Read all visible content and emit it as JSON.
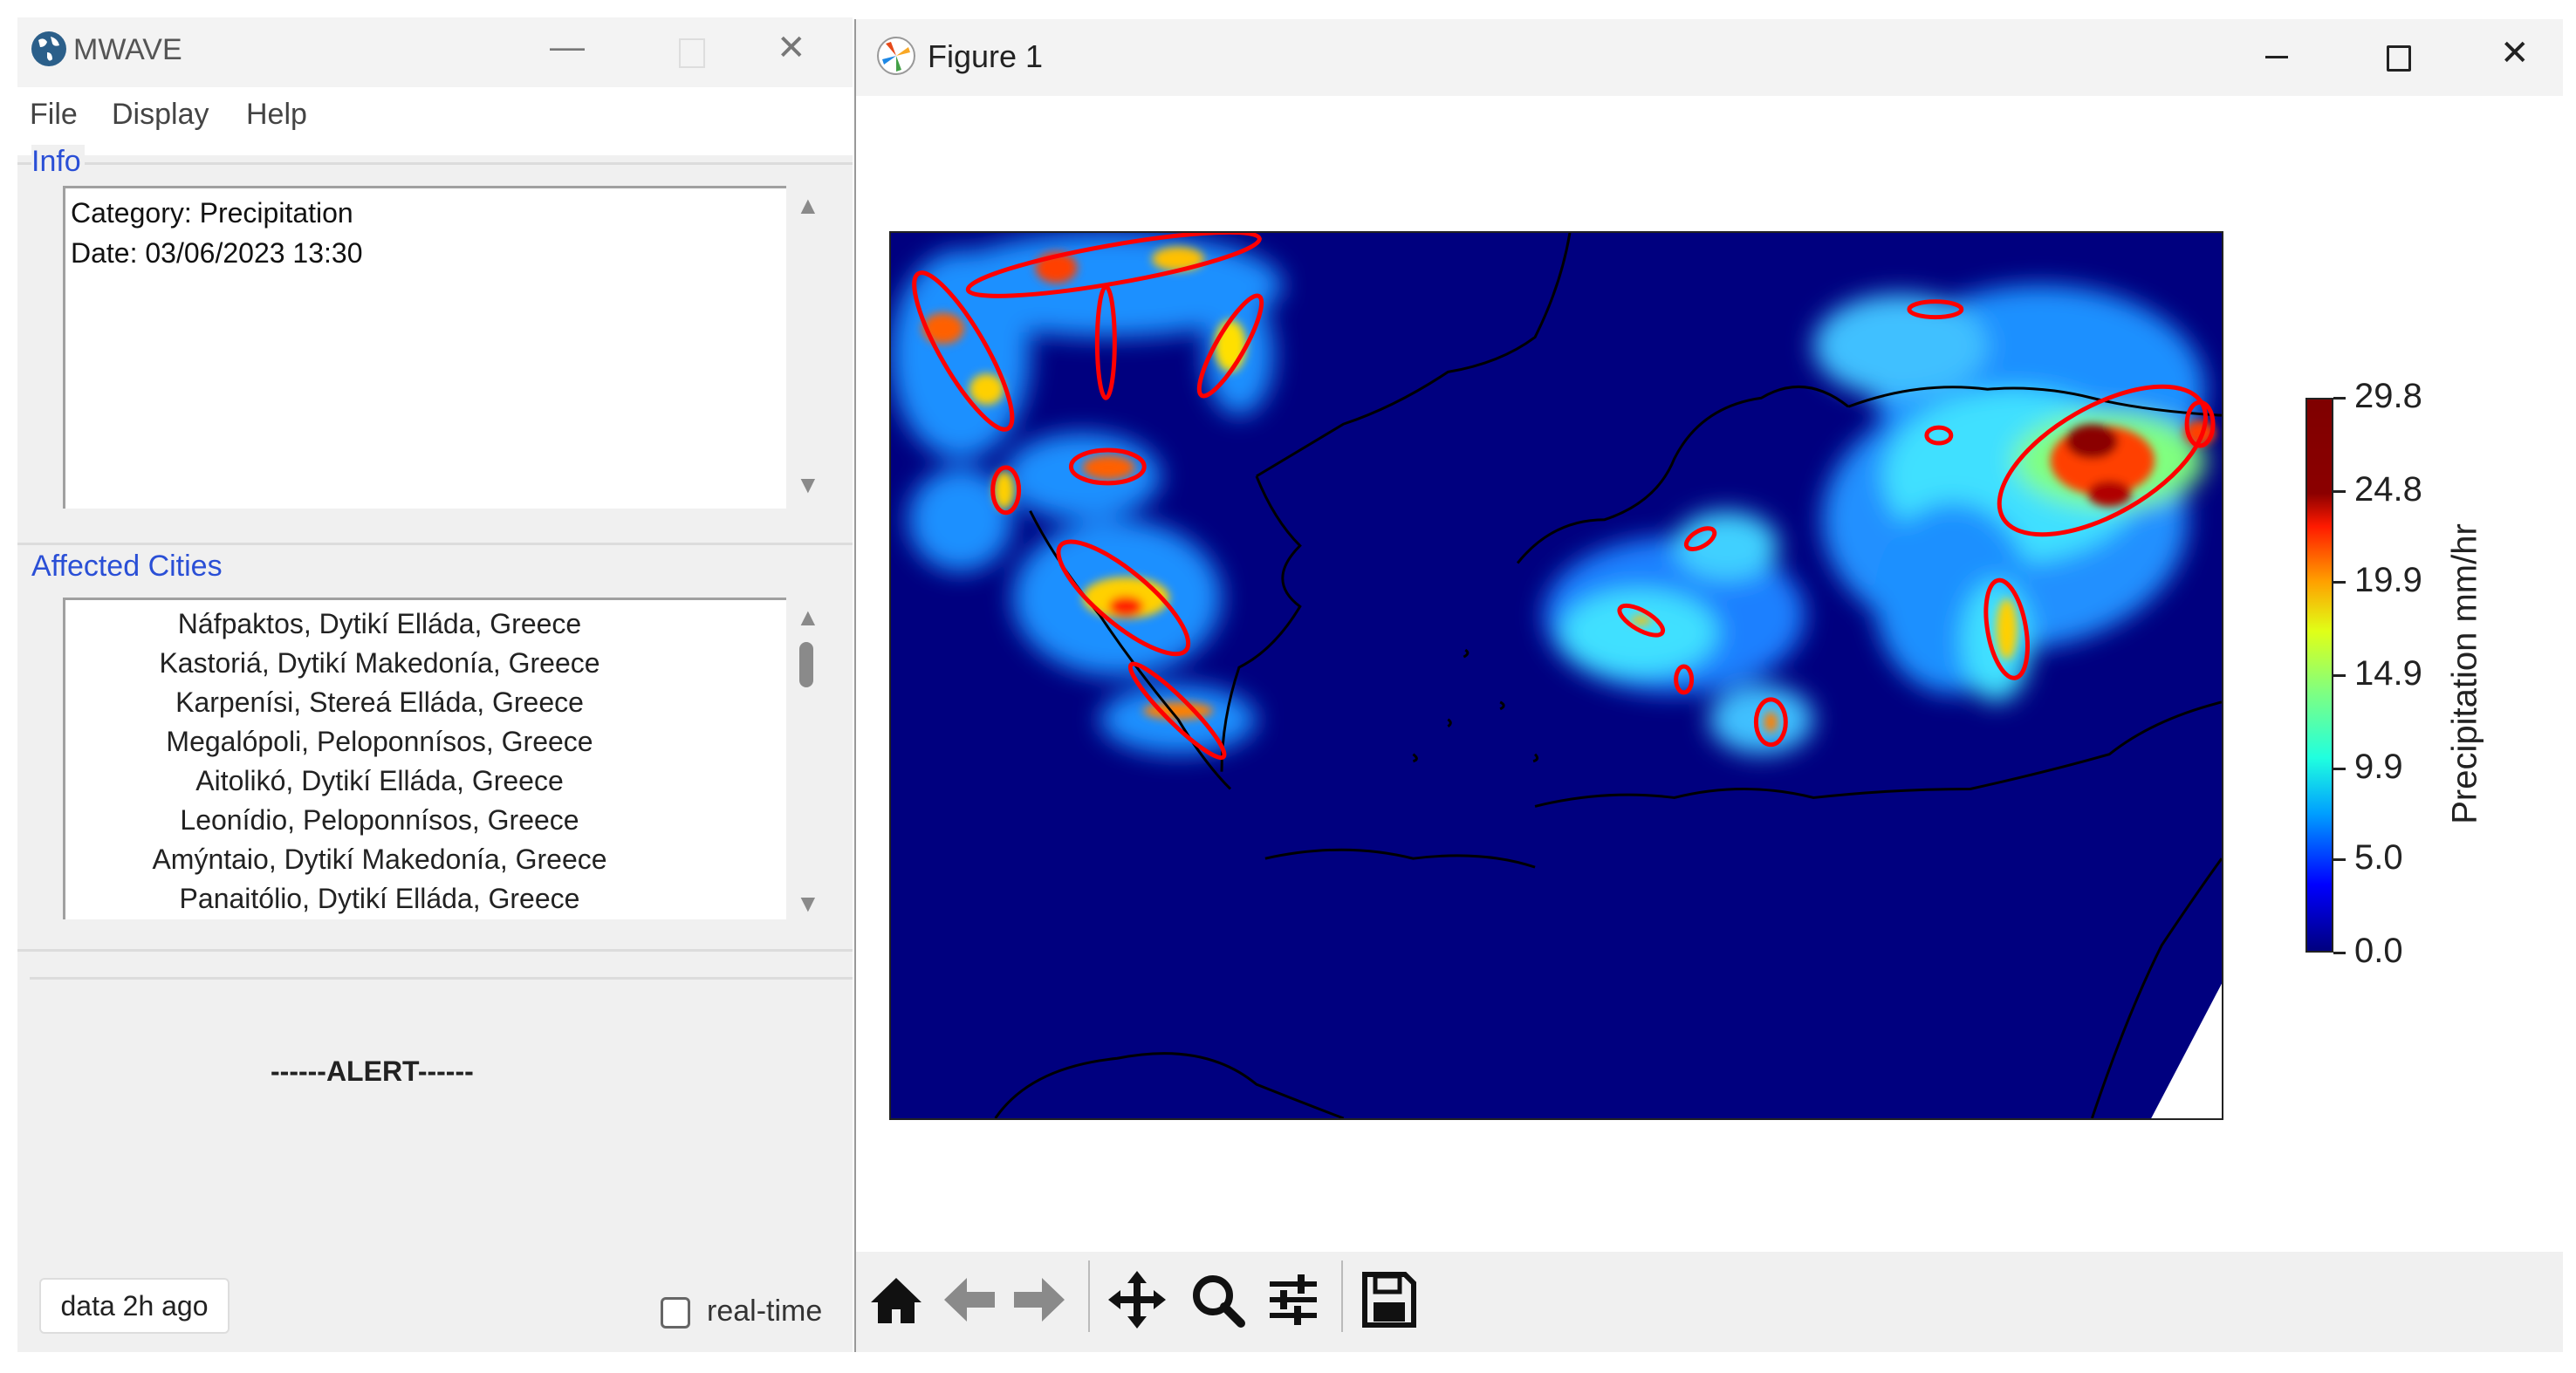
{
  "mwave_window": {
    "title": "MWAVE",
    "icon": "globe-icon",
    "menu": [
      "File",
      "Display",
      "Help"
    ],
    "info": {
      "label": "Info",
      "lines": [
        "Category: Precipitation",
        "Date: 03/06/2023 13:30"
      ]
    },
    "affected_cities": {
      "label": "Affected Cities",
      "items": [
        "Náfpaktos, Dytikí Elláda, Greece",
        "Kastoriá, Dytikí Makedonía, Greece",
        "Karpenísi, Stereá Elláda, Greece",
        "Megalópoli, Peloponnísos, Greece",
        "Aitolikó, Dytikí Elláda, Greece",
        "Leonídio, Peloponnísos, Greece",
        "Amýntaio, Dytikí Makedonía, Greece",
        "Panaitólio, Dytikí Elláda, Greece"
      ]
    },
    "alert_text": "------ALERT------",
    "data_button": "data 2h ago",
    "realtime_label": "real-time",
    "realtime_checked": false
  },
  "figure_window": {
    "title": "Figure 1",
    "icon": "matplotlib-icon",
    "toolbar": [
      "home-icon",
      "back-arrow-icon",
      "forward-arrow-icon",
      "pan-icon",
      "zoom-icon",
      "configure-subplots-icon",
      "save-icon"
    ]
  },
  "chart_data": {
    "type": "heatmap",
    "title": "",
    "colormap": "jet",
    "colorbar": {
      "label": "Precipitation mm/hr",
      "ticks": [
        "0.0",
        "5.0",
        "9.9",
        "14.9",
        "19.9",
        "24.8",
        "29.8"
      ],
      "range": [
        0.0,
        29.8
      ]
    },
    "annotations": "red ellipses around high-precipitation areas",
    "colors": {
      "background": "#00007f",
      "ellipse": "#ff0000"
    }
  }
}
